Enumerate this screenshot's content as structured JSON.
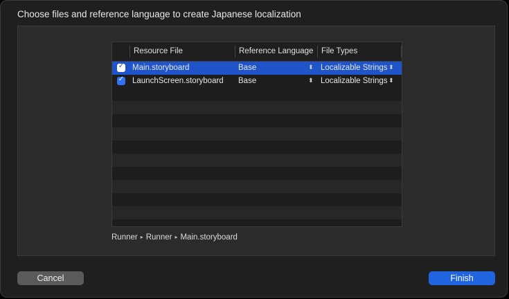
{
  "dialog": {
    "title": "Choose files and reference language to create Japanese localization"
  },
  "table": {
    "columns": {
      "resource_file": "Resource File",
      "reference_language": "Reference Language",
      "file_types": "File Types"
    },
    "rows": [
      {
        "checked": true,
        "resource_file": "Main.storyboard",
        "reference_language": "Base",
        "file_type": "Localizable Strings",
        "selected": true
      },
      {
        "checked": true,
        "resource_file": "LaunchScreen.storyboard",
        "reference_language": "Base",
        "file_type": "Localizable Strings",
        "selected": false
      }
    ]
  },
  "breadcrumb": [
    "Runner",
    "Runner",
    "Main.storyboard"
  ],
  "buttons": {
    "cancel": "Cancel",
    "finish": "Finish"
  },
  "icons": {
    "checkbox": "checkmark-icon",
    "popup": "up-down-chevron-icon",
    "breadcrumb_separator": "triangle-right-icon"
  },
  "colors": {
    "accent": "#2164e0",
    "selection": "#1f55c9"
  }
}
